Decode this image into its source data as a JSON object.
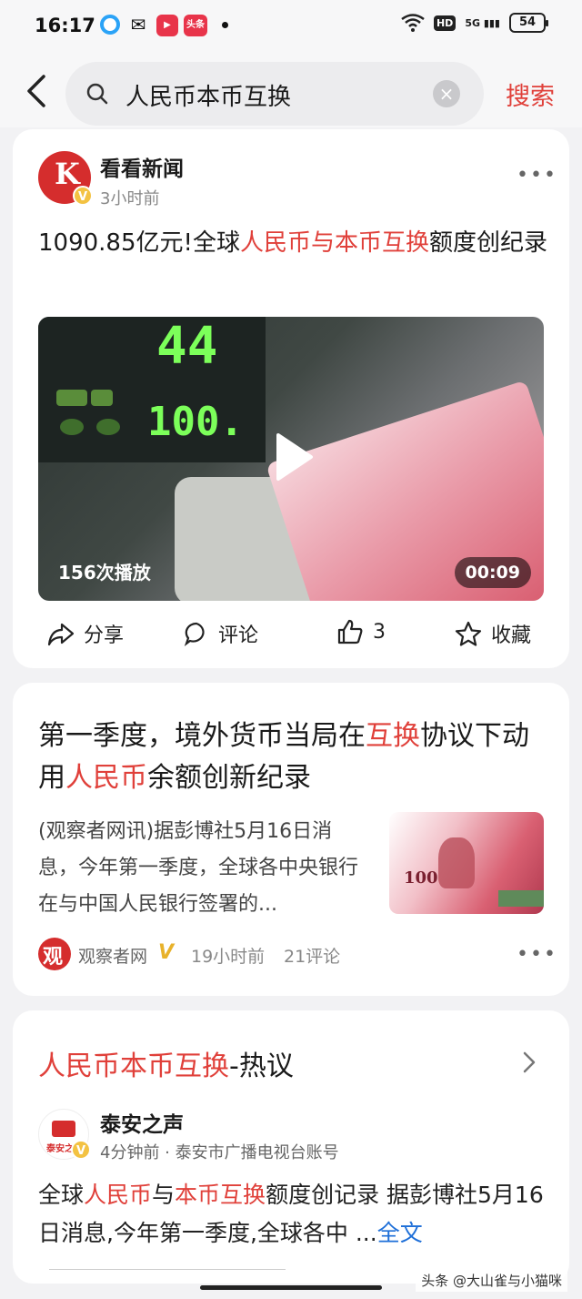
{
  "status": {
    "time": "16:17",
    "app_icons": [
      {
        "name": "browser-app-icon",
        "color": "#2ba3f7",
        "label": ""
      },
      {
        "name": "wechat-app-icon",
        "color": "#111111",
        "label": ""
      },
      {
        "name": "video-app-icon",
        "color": "#e8344a",
        "label": ""
      },
      {
        "name": "toutiao-app-icon",
        "color": "#e8344a",
        "label": "头条"
      }
    ],
    "network": "HD",
    "signal": "5G",
    "battery": "54"
  },
  "search": {
    "query": "人民币本币互换",
    "button_label": "搜索"
  },
  "colors": {
    "accent_red": "#e0403a",
    "link_blue": "#1e6fd8"
  },
  "card1": {
    "source": "看看新闻",
    "time_ago": "3小时前",
    "title_pre": "1090.85亿元!全球",
    "title_hl": "人民币与本币互换",
    "title_post": "额度创纪录",
    "video": {
      "digits_top": "44",
      "digits_bottom": "100.",
      "plays": "156次播放",
      "duration": "00:09"
    },
    "actions": {
      "share": "分享",
      "comment": "评论",
      "like_count": "3",
      "favorite": "收藏"
    }
  },
  "card2": {
    "title_a": "第一季度，境外货币当局在",
    "title_hl1": "互换",
    "title_b": "协议下动用",
    "title_hl2": "人民币",
    "title_c": "余额创新纪录",
    "summary": "(观察者网讯)据彭博社5月16日消息，今年第一季度，全球各中央银行在与中国人民银行签署的...",
    "source": "观察者网",
    "time_ago": "19小时前",
    "comments": "21评论",
    "thumb_number": "100"
  },
  "card3": {
    "header_hl": "人民币本币互换",
    "header_suffix": "-热议",
    "source": "泰安之声",
    "time_ago": "4分钟前",
    "account": "泰安市广播电视台账号",
    "body_a": "全球",
    "body_hl1": "人民币",
    "body_b": "与",
    "body_hl2": "本币互换",
    "body_c": "额度创记录 据彭博社5月16日消息,今年第一季度,全球各中 ...",
    "full_text": "全文"
  },
  "watermark": "头条 @大山雀与小猫咪"
}
